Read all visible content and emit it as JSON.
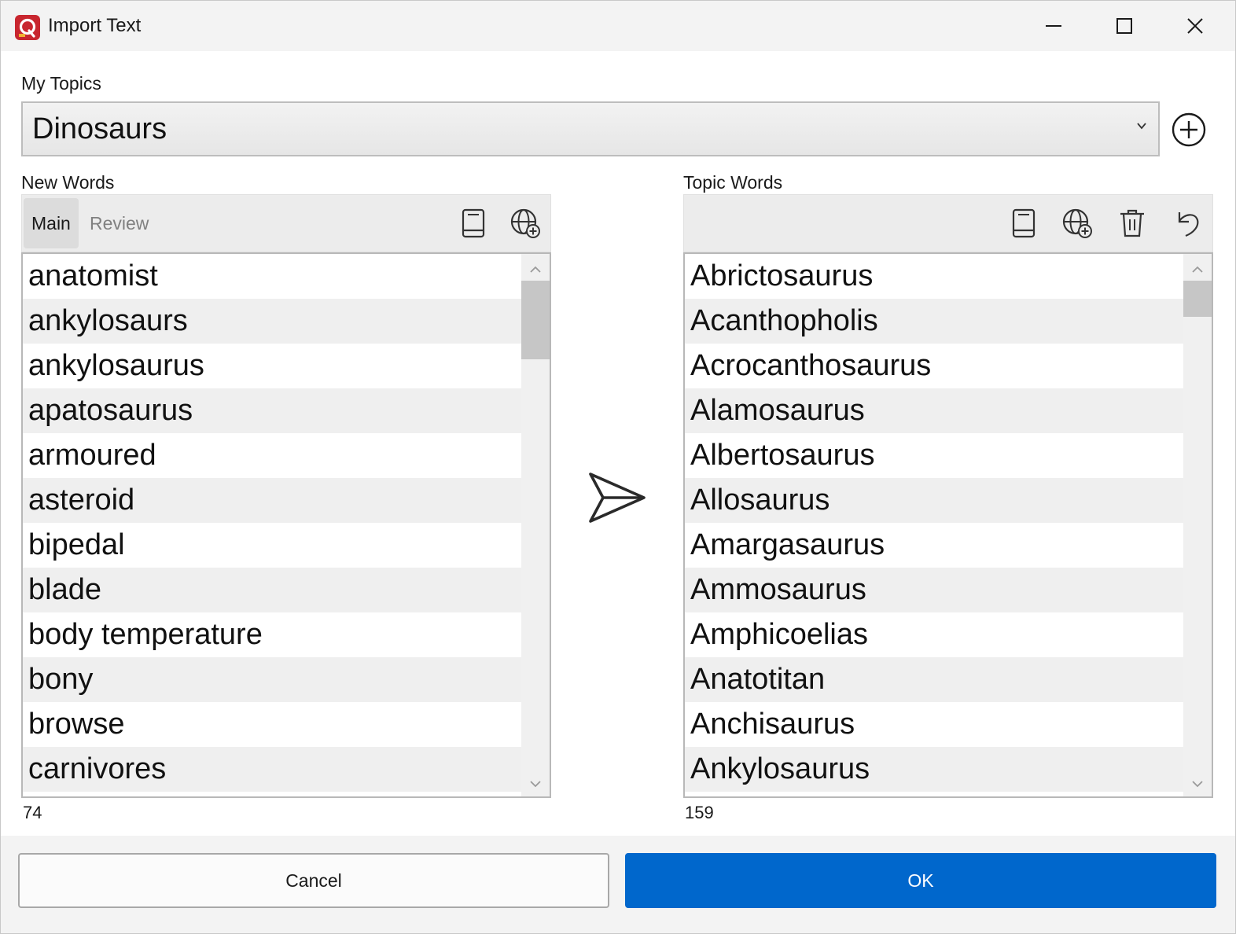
{
  "window": {
    "title": "Import Text",
    "accent_color": "#0067cc",
    "app_icon_color": "#c8262f"
  },
  "topics": {
    "label": "My Topics",
    "selected": "Dinosaurs"
  },
  "new_words": {
    "label": "New Words",
    "tabs": [
      {
        "label": "Main",
        "active": true
      },
      {
        "label": "Review",
        "active": false
      }
    ],
    "toolbar_icons": [
      "book-icon",
      "globe-add-icon"
    ],
    "items": [
      "anatomist",
      "ankylosaurs",
      "ankylosaurus",
      "apatosaurus",
      "armoured",
      "asteroid",
      "bipedal",
      "blade",
      "body temperature",
      "bony",
      "browse",
      "carnivores"
    ],
    "count": "74"
  },
  "topic_words": {
    "label": "Topic Words",
    "toolbar_icons": [
      "book-icon",
      "globe-add-icon",
      "trash-icon",
      "undo-icon"
    ],
    "items": [
      "Abrictosaurus",
      "Acanthopholis",
      "Acrocanthosaurus",
      "Alamosaurus",
      "Albertosaurus",
      "Allosaurus",
      "Amargasaurus",
      "Ammosaurus",
      "Amphicoelias",
      "Anatotitan",
      "Anchisaurus",
      "Ankylosaurus"
    ],
    "count": "159"
  },
  "footer": {
    "cancel_label": "Cancel",
    "ok_label": "OK"
  }
}
